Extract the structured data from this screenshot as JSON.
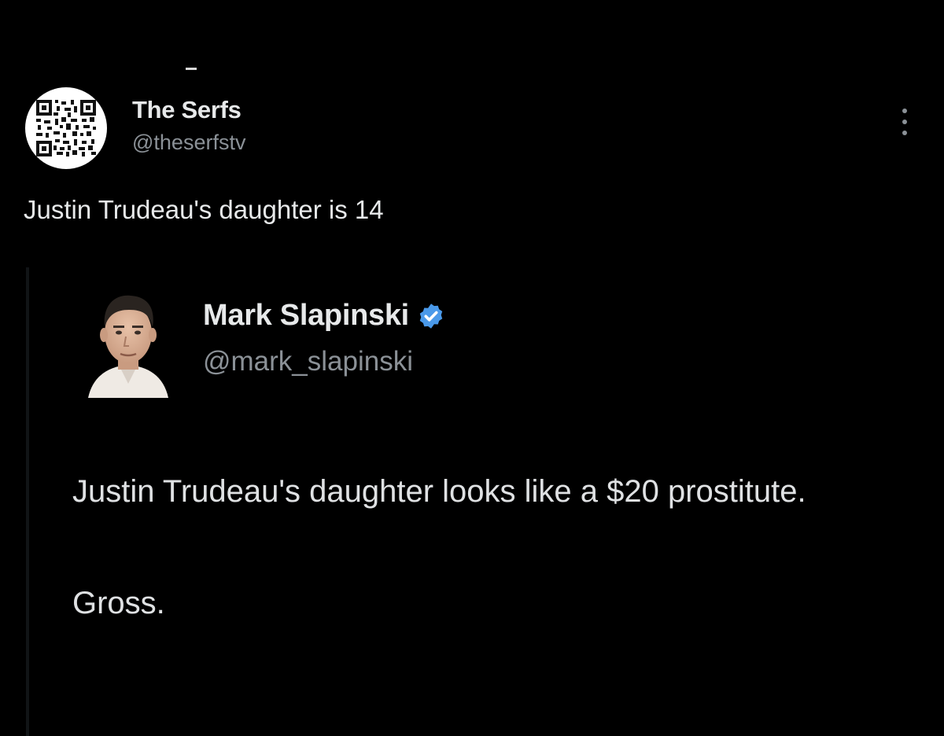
{
  "tweet": {
    "author_name": "The Serfs",
    "author_handle": "@theserfstv",
    "avatar_icon": "qr-code-avatar-icon",
    "more_icon": "more-options-icon",
    "text": "Justin Trudeau's daughter is 14"
  },
  "quoted_tweet": {
    "author_name": "Mark Slapinski",
    "author_handle": "@mark_slapinski",
    "verified_icon": "verified-badge-icon",
    "verified_color": "#4a99e9",
    "body_line_1": "Justin Trudeau's daughter looks like a $20 prostitute.",
    "body_line_2": "Gross."
  },
  "colors": {
    "background": "#000000",
    "primary_text": "#e7e9ea",
    "secondary_text": "#8b9197"
  }
}
